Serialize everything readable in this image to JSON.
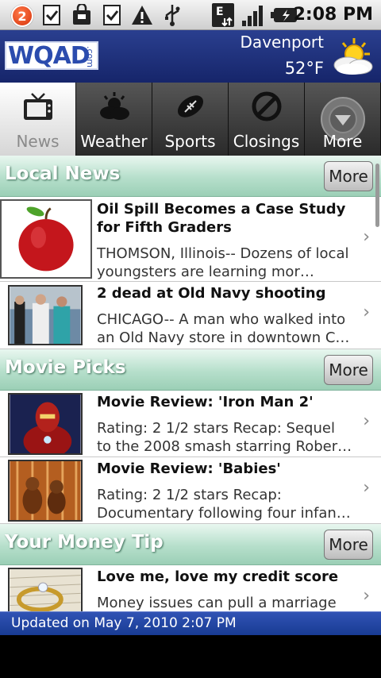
{
  "status_bar": {
    "notification_count": "2",
    "time": "2:08 PM",
    "icons": [
      "notification-badge",
      "task-check-icon",
      "bag-icon",
      "task-check-icon",
      "warning-icon",
      "usb-icon",
      "edge-data-icon",
      "signal-icon",
      "battery-icon"
    ]
  },
  "header": {
    "logo_text": "WQAD",
    "logo_suffix": ".com",
    "city": "Davenport",
    "temperature": "52°F",
    "weather_icon": "partly-cloudy-icon"
  },
  "tabs": [
    {
      "label": "News",
      "icon": "tv-icon",
      "active": true
    },
    {
      "label": "Weather",
      "icon": "cloud-icon",
      "active": false
    },
    {
      "label": "Sports",
      "icon": "football-icon",
      "active": false
    },
    {
      "label": "Closings",
      "icon": "no-entry-icon",
      "active": false
    },
    {
      "label": "More",
      "icon": "chevron-down-icon",
      "active": false
    }
  ],
  "sections": [
    {
      "title": "Local News",
      "more_label": "More",
      "items": [
        {
          "title": "Oil Spill Becomes a Case Study for Fifth Graders",
          "desc": "THOMSON, Illinois-- Dozens of local youngsters are learning mor…",
          "thumb": "apple"
        },
        {
          "title": "2 dead at Old Navy shooting",
          "desc": "CHICAGO-- A man who walked into an Old Navy store in downtown C…",
          "thumb": "police-scene"
        }
      ]
    },
    {
      "title": "Movie Picks",
      "more_label": "More",
      "items": [
        {
          "title": "Movie Review: 'Iron Man 2'",
          "desc": "Rating: 2 1/2 stars Recap: Sequel to the 2008 smash starring Rober…",
          "thumb": "iron-man"
        },
        {
          "title": "Movie Review: 'Babies'",
          "desc": "Rating: 2 1/2 stars Recap: Documentary following four infan…",
          "thumb": "babies"
        }
      ]
    },
    {
      "title": "Your Money Tip",
      "more_label": "More",
      "items": [
        {
          "title": "Love me, love my credit score",
          "desc": "Money issues can pull a marriage",
          "thumb": "ring"
        }
      ]
    }
  ],
  "footer": {
    "updated_text": "Updated on May 7, 2010 2:07 PM"
  },
  "colors": {
    "header_blue": "#1f3280",
    "section_green": "#b6dfcb",
    "footer_blue": "#2748a8"
  }
}
